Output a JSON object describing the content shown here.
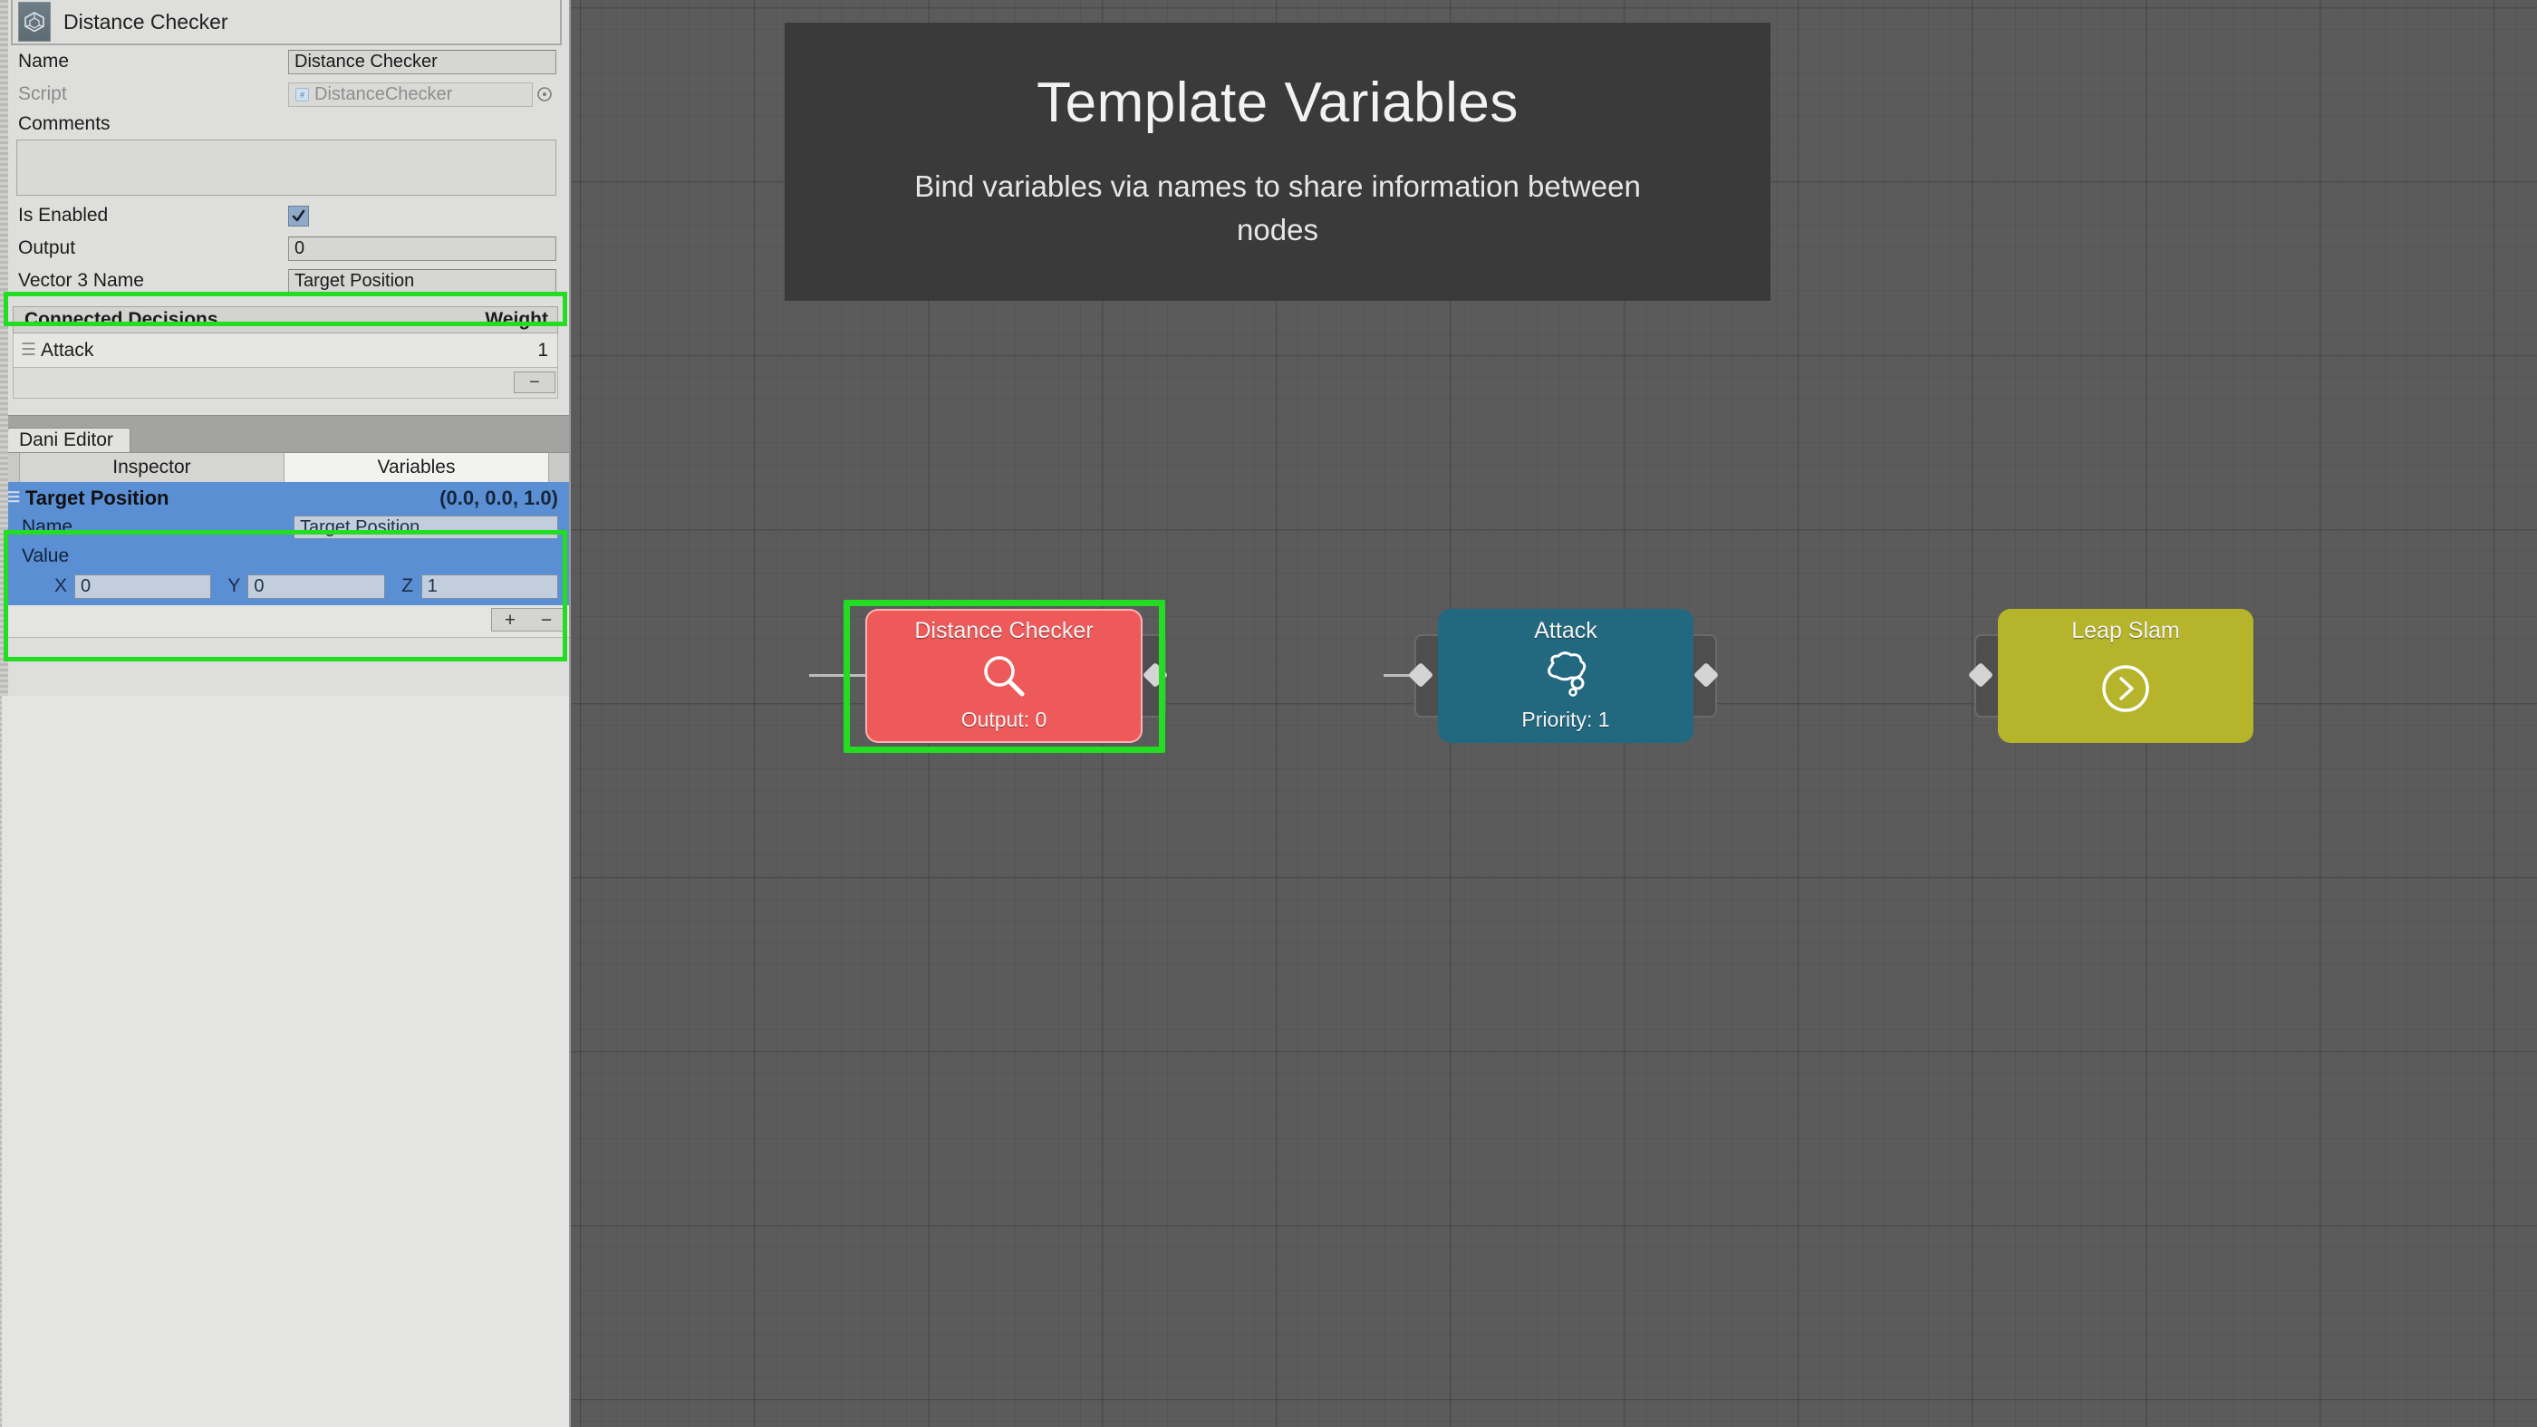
{
  "banner": {
    "title": "Template Variables",
    "subtitle": "Bind variables via names to share information between nodes"
  },
  "inspector": {
    "header_title": "Distance Checker",
    "fields": {
      "name_label": "Name",
      "name_value": "Distance Checker",
      "script_label": "Script",
      "script_value": "DistanceChecker",
      "comments_label": "Comments",
      "comments_value": "",
      "is_enabled_label": "Is Enabled",
      "is_enabled_checked": true,
      "output_label": "Output",
      "output_value": "0",
      "vector3_name_label": "Vector 3 Name",
      "vector3_name_value": "Target Position"
    },
    "connected_decisions": {
      "title": "Connected Decisions",
      "weight_header": "Weight",
      "rows": [
        {
          "name": "Attack",
          "weight": "1"
        }
      ],
      "remove_button": "−"
    }
  },
  "editor_window": {
    "window_tab": "Dani Editor",
    "tabs": [
      {
        "label": "Inspector",
        "active": false
      },
      {
        "label": "Variables",
        "active": true
      }
    ]
  },
  "variables": {
    "entries": [
      {
        "name": "Target Position",
        "readout": "(0.0, 0.0, 1.0)",
        "name_label": "Name",
        "name_value": "Target Position",
        "value_label": "Value",
        "x_label": "X",
        "x_value": "0",
        "y_label": "Y",
        "y_value": "0",
        "z_label": "Z",
        "z_value": "1"
      }
    ],
    "add_button": "+",
    "remove_button": "−"
  },
  "graph": {
    "nodes": [
      {
        "title": "Distance Checker",
        "status": "Output: 0",
        "icon": "magnifier-icon",
        "color": "#ee5a5a",
        "highlighted": true
      },
      {
        "title": "Attack",
        "status": "Priority: 1",
        "icon": "thought-bubble-icon",
        "color": "#22687f",
        "highlighted": false
      },
      {
        "title": "Leap Slam",
        "status": "",
        "icon": "circle-chevron-right-icon",
        "color": "#b5b42b",
        "highlighted": false
      }
    ]
  },
  "colors": {
    "highlight": "#22dd22",
    "canvas_bg": "#5b5b5b",
    "banner_bg": "#383838",
    "panel_bg": "#dededc",
    "selection_blue": "#5b8fd4"
  }
}
